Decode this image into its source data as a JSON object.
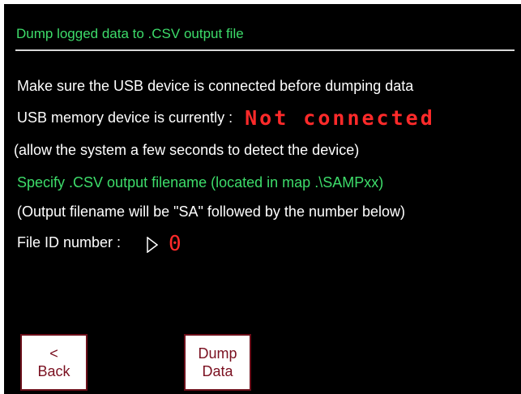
{
  "title": "Dump logged data to .CSV output file",
  "instructions": {
    "make_sure": "Make sure the USB device is connected before dumping data",
    "usb_status_label": "USB memory device is currently :",
    "usb_status_value": "Not connected",
    "allow_time": "(allow the system a few seconds to detect the device)"
  },
  "filename": {
    "specify": "Specify .CSV output filename (located in map .\\SAMPxx)",
    "note": "(Output filename will be \"SA\" followed by the number below)",
    "file_id_label": "File ID number :",
    "file_id_value": "0"
  },
  "buttons": {
    "back_line1": "<",
    "back_line2": "Back",
    "dump_line1": "Dump",
    "dump_line2": "Data"
  },
  "colors": {
    "background": "#000000",
    "accent_green": "#3ddc6a",
    "status_red": "#ff2a2a",
    "button_text": "#7a1020"
  }
}
